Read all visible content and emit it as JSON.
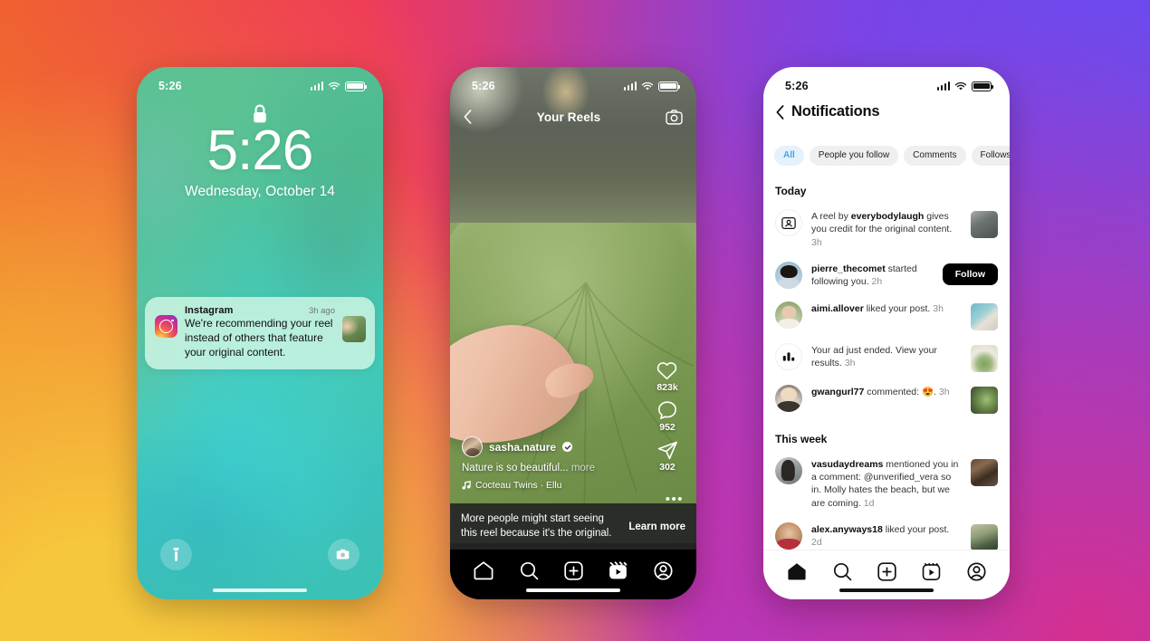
{
  "background": {
    "gradient_colors": [
      "#f6c63c",
      "#f07a2a",
      "#ef5a2b",
      "#ee3556",
      "#d62f8f",
      "#a13bd4",
      "#6d4cf2"
    ]
  },
  "phones": {
    "lock": {
      "status_bar": {
        "time": "5:26",
        "signal": "signal-bars-icon",
        "wifi": "wifi-icon",
        "battery": "battery-icon"
      },
      "lock_icon": "lock-icon",
      "clock_time": "5:26",
      "clock_date": "Wednesday, October 14",
      "notification": {
        "app_icon": "instagram-logo-icon",
        "app_name": "Instagram",
        "timestamp": "3h ago",
        "message": "We're recommending your reel instead of others that feature your original content.",
        "thumbnail": "reel-thumbnail"
      },
      "flashlight_label": "flashlight-icon",
      "camera_label": "camera-icon"
    },
    "reels": {
      "status_bar": {
        "time": "5:26"
      },
      "back_icon": "chevron-left-icon",
      "title": "Your Reels",
      "camera_icon": "camera-icon",
      "actions": [
        {
          "icon": "heart-icon",
          "count": "823k"
        },
        {
          "icon": "comment-icon",
          "count": "952"
        },
        {
          "icon": "share-icon",
          "count": "302"
        }
      ],
      "author": "sasha.nature",
      "verified": true,
      "caption": "Nature is so beautiful...",
      "caption_more": "more",
      "audio": "Cocteau Twins · Ellu",
      "more_dots": "•••",
      "banner": {
        "text": "More people might start seeing this reel because it's the original.",
        "cta": "Learn more"
      },
      "tabs": [
        "home-icon",
        "search-icon",
        "create-icon",
        "reels-icon",
        "profile-icon"
      ]
    },
    "notifications": {
      "status_bar": {
        "time": "5:26"
      },
      "back_icon": "chevron-left-icon",
      "title": "Notifications",
      "filters": [
        {
          "label": "All",
          "active": true
        },
        {
          "label": "People you follow",
          "active": false
        },
        {
          "label": "Comments",
          "active": false
        },
        {
          "label": "Follows",
          "active": false
        }
      ],
      "sections": [
        {
          "header": "Today",
          "items": [
            {
              "avatar_type": "credit-badge-icon",
              "text_prefix": "A reel by ",
              "bold": "everybodylaugh",
              "text_suffix": " gives you credit for the original content.",
              "time": "3h",
              "trailing": "thumbnail",
              "thumb_style": 0
            },
            {
              "avatar_type": "photo",
              "avatar_style": 0,
              "text_prefix": "",
              "bold": "pierre_thecomet",
              "text_suffix": " started following you.",
              "time": "2h",
              "trailing": "follow-button",
              "button_label": "Follow"
            },
            {
              "avatar_type": "photo",
              "avatar_style": 1,
              "text_prefix": "",
              "bold": "aimi.allover",
              "text_suffix": " liked your post.",
              "time": "3h",
              "trailing": "thumbnail",
              "thumb_style": 1
            },
            {
              "avatar_type": "chart-badge-icon",
              "text_prefix": "",
              "bold": "",
              "text_suffix": "Your ad just ended. View your results.",
              "time": "3h",
              "trailing": "thumbnail",
              "thumb_style": 2
            },
            {
              "avatar_type": "photo",
              "avatar_style": 2,
              "text_prefix": "",
              "bold": "gwangurl77",
              "text_suffix": " commented: 😍.",
              "time": "3h",
              "trailing": "thumbnail",
              "thumb_style": 3
            }
          ]
        },
        {
          "header": "This week",
          "items": [
            {
              "avatar_type": "photo",
              "avatar_style": 3,
              "text_prefix": "",
              "bold": "vasudaydreams",
              "text_suffix": " mentioned you in a comment: @unverified_vera so in. Molly hates the beach, but we are coming.",
              "time": "1d",
              "trailing": "thumbnail",
              "thumb_style": 4
            },
            {
              "avatar_type": "photo",
              "avatar_style": 4,
              "text_prefix": "",
              "bold": "alex.anyways18",
              "text_suffix": " liked your post.",
              "time": "2d",
              "trailing": "thumbnail",
              "thumb_style": 5
            }
          ]
        }
      ],
      "tabs": [
        "home-icon",
        "search-icon",
        "create-icon",
        "reels-icon",
        "profile-icon"
      ]
    }
  }
}
